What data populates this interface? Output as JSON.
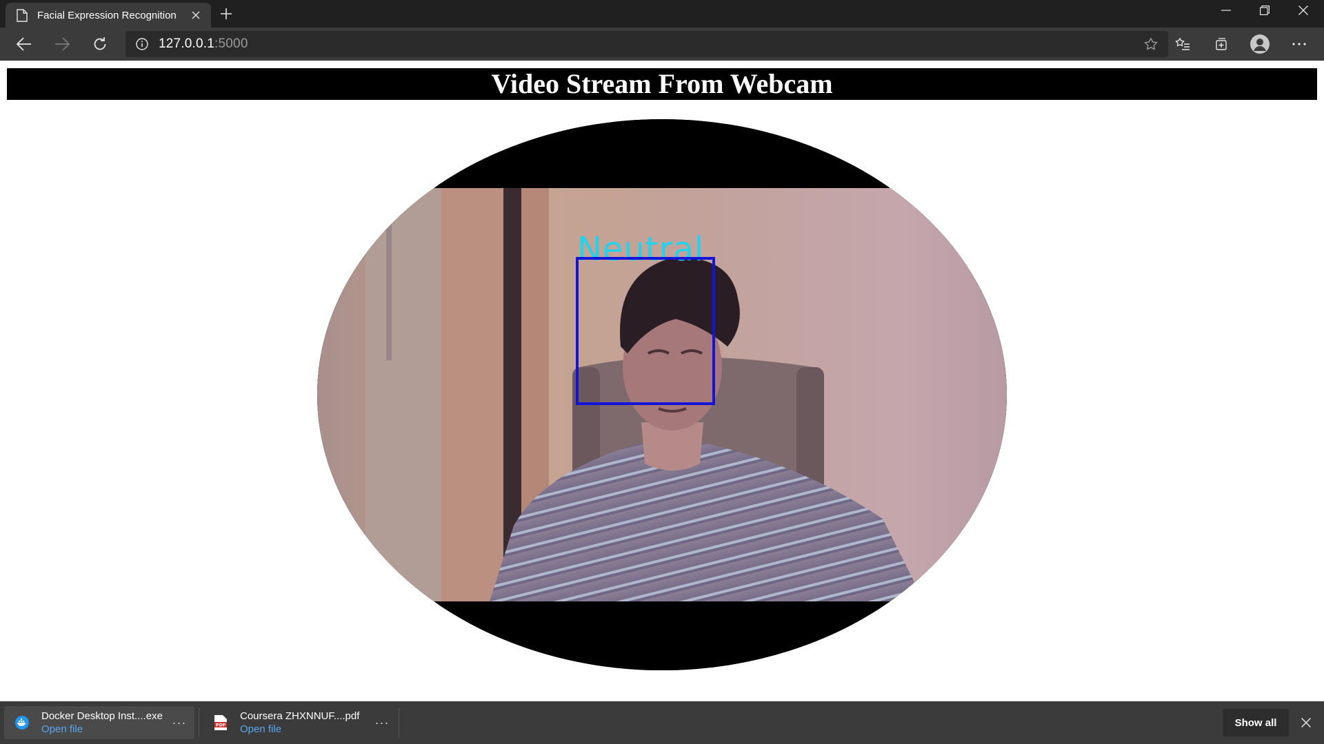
{
  "browser": {
    "tab_title": "Facial Expression Recognition",
    "url_host": "127.0.0.1",
    "url_port": ":5000",
    "accent_color": "#3b3b3b"
  },
  "page": {
    "heading": "Video Stream From Webcam",
    "emotion_label": "Neutral",
    "label_color": "#22d3ee",
    "box_color": "#1414d8"
  },
  "downloads": {
    "items": [
      {
        "name": "Docker Desktop Inst....exe",
        "action": "Open file",
        "icon": "docker-icon"
      },
      {
        "name": "Coursera ZHXNNUF....pdf",
        "action": "Open file",
        "icon": "pdf-icon"
      }
    ],
    "more_label": "···",
    "show_all_label": "Show all"
  }
}
